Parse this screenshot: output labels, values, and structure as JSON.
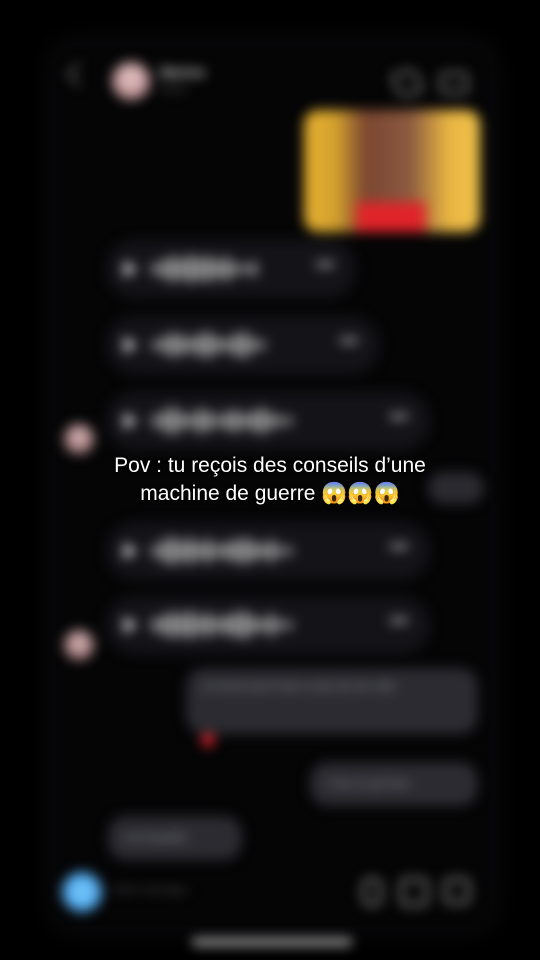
{
  "header": {
    "contact_name": "Marine",
    "status": "Active"
  },
  "icons": {
    "back": "chevron-left-icon",
    "call": "phone-icon",
    "video": "video-camera-icon",
    "camera": "camera-icon",
    "mic": "microphone-icon",
    "gallery": "image-icon",
    "sticker": "sticker-icon"
  },
  "messages": {
    "sent_1": "Je trouve qu'on faut un peu de son côté",
    "sent_2": "C'est ce qu'il faut",
    "received_1": "oui tranquille"
  },
  "composer": {
    "placeholder": "Votre message..."
  },
  "overlay": {
    "line1": "Pov : tu reçois des conseils d’une",
    "line2": "machine de guerre 😱😱😱"
  },
  "colors": {
    "background": "#000000",
    "bubble": "#2b2b31",
    "accent": "#2f8be0",
    "heart": "#e0242a"
  }
}
